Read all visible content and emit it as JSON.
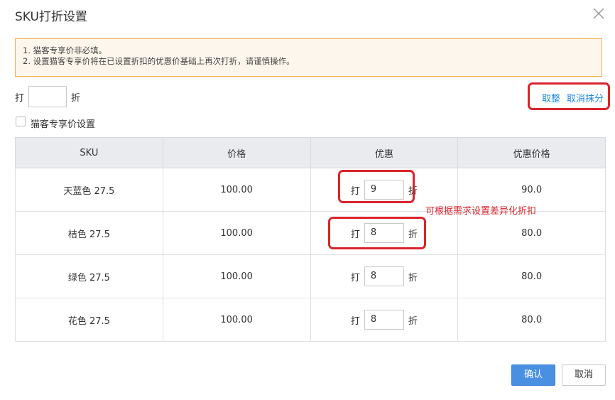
{
  "dialog": {
    "title": "SKU打折设置",
    "notice": {
      "line1": "1. 猫客专享价非必填。",
      "line2": "2. 设置猫客专享价将在已设置折扣的优惠价基础上再次打折，请谨慎操作。"
    },
    "global_discount": {
      "prefix": "打",
      "value": "",
      "suffix": "折"
    },
    "actions": {
      "round": "取整",
      "cancel_round": "取消抹分"
    },
    "maoke_checkbox_label": "猫客专享价设置",
    "table": {
      "headers": [
        "SKU",
        "价格",
        "优惠",
        "优惠价格"
      ],
      "rows": [
        {
          "sku": "天蓝色 27.5",
          "price": "100.00",
          "discount": "9",
          "final": "90.0"
        },
        {
          "sku": "桔色 27.5",
          "price": "100.00",
          "discount": "8",
          "final": "80.0"
        },
        {
          "sku": "绿色 27.5",
          "price": "100.00",
          "discount": "8",
          "final": "80.0"
        },
        {
          "sku": "花色 27.5",
          "price": "100.00",
          "discount": "8",
          "final": "80.0"
        }
      ],
      "discount_prefix": "打",
      "discount_suffix": "折"
    },
    "annotation": "可根据需求设置差异化折扣",
    "buttons": {
      "confirm": "确认",
      "cancel": "取消"
    }
  },
  "colors": {
    "accent": "#4a90e2",
    "link": "#1e88e5",
    "highlight": "#d9242b",
    "notice_border": "#f0ad4e"
  }
}
